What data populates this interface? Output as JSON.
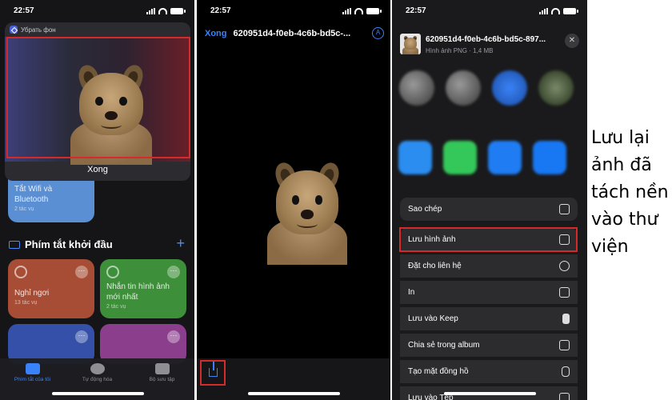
{
  "status": {
    "time": "22:57"
  },
  "panel1": {
    "shortcut_title": "Убрать фон",
    "done_label": "Xong",
    "tile_wifi": {
      "title": "Tắt Wifi và Bluetooth",
      "subtitle": "2 tác vụ"
    },
    "section_title": "Phím tắt khởi đầu",
    "tiles": [
      {
        "title": "Nghỉ ngơi",
        "subtitle": "13 tác vụ"
      },
      {
        "title": "Nhắn tin hình ảnh mới nhất",
        "subtitle": "2 tác vụ"
      }
    ],
    "tabs": [
      "Phím tắt của tôi",
      "Tự động hóa",
      "Bộ sưu tập"
    ]
  },
  "panel2": {
    "done_label": "Xong",
    "file_name": "620951d4-f0eb-4c6b-bd5c-...",
    "markup_glyph": "A"
  },
  "panel3": {
    "file_name": "620951d4-f0eb-4c6b-bd5c-897...",
    "file_meta": "Hình ảnh PNG · 1,4 MB",
    "close_glyph": "✕",
    "actions": [
      {
        "label": "Sao chép",
        "icon": "copy-icon"
      },
      {
        "label": "Lưu hình ảnh",
        "icon": "save-image-icon"
      },
      {
        "label": "Đặt cho liên hệ",
        "icon": "contact-icon"
      },
      {
        "label": "In",
        "icon": "print-icon"
      },
      {
        "label": "Lưu vào Keep",
        "icon": "bookmark-icon"
      },
      {
        "label": "Chia sẻ trong album",
        "icon": "album-icon"
      },
      {
        "label": "Tạo mặt đồng hồ",
        "icon": "watch-icon"
      },
      {
        "label": "Lưu vào Tệp",
        "icon": "folder-icon"
      }
    ]
  },
  "caption": "Lưu lại ảnh đã tách nền vào thư viện",
  "colors": {
    "accent": "#3a82f7",
    "highlight": "#d42a2a"
  }
}
